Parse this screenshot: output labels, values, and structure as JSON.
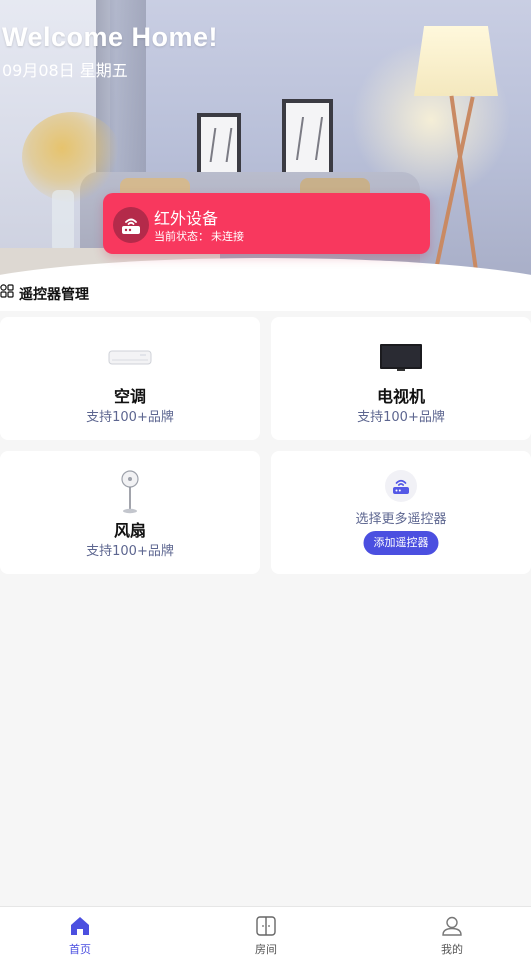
{
  "hero": {
    "title": "Welcome  Home!",
    "date": "09月08日  星期五"
  },
  "ir_device": {
    "title": "红外设备",
    "status_label": "当前状态：",
    "status_value": "未连接",
    "icon": "router-icon",
    "color": "#f8385e"
  },
  "section": {
    "title": "遥控器管理",
    "icon": "grid-icon"
  },
  "cards": [
    {
      "title": "空调",
      "subtitle": "支持100+品牌",
      "icon": "air-conditioner-icon"
    },
    {
      "title": "电视机",
      "subtitle": "支持100+品牌",
      "icon": "tv-icon"
    },
    {
      "title": "风扇",
      "subtitle": "支持100+品牌",
      "icon": "fan-icon"
    },
    {
      "subtitle": "选择更多遥控器",
      "button": "添加遥控器",
      "icon": "router-icon"
    }
  ],
  "nav": {
    "items": [
      {
        "label": "首页",
        "icon": "home-icon",
        "active": true
      },
      {
        "label": "房间",
        "icon": "room-icon",
        "active": false
      },
      {
        "label": "我的",
        "icon": "user-icon",
        "active": false
      }
    ],
    "active_color": "#4b4fe0",
    "inactive_color": "#555555"
  }
}
